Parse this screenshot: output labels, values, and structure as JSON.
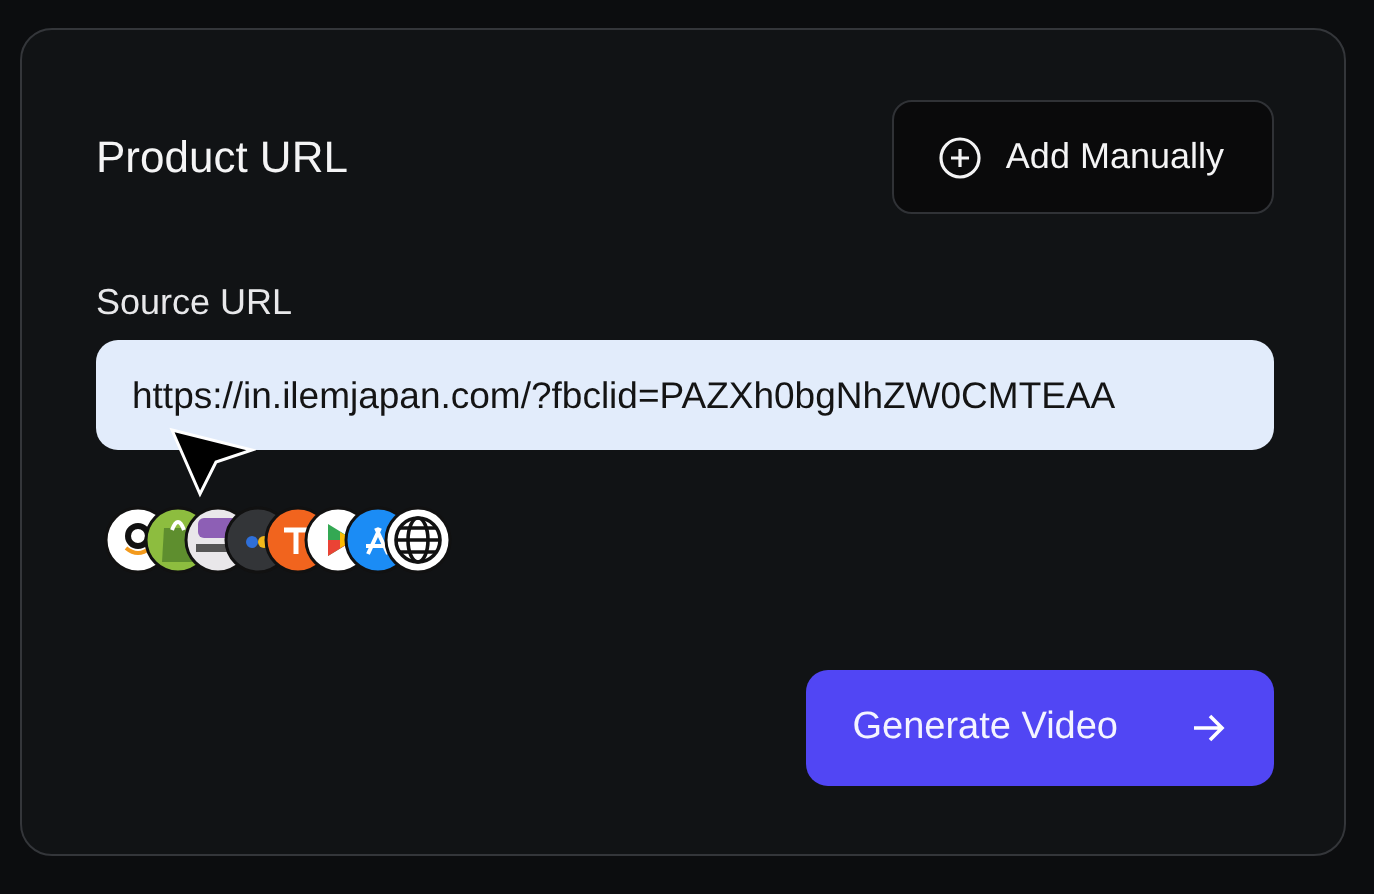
{
  "card": {
    "title": "Product URL",
    "add_button": {
      "label": "Add Manually"
    },
    "source": {
      "label": "Source URL",
      "value": "https://in.ilemjapan.com/?fbclid=PAZXh0bgNhZW0CMTEAA"
    },
    "platforms": [
      {
        "kind": "smile"
      },
      {
        "kind": "bag"
      },
      {
        "kind": "bubble"
      },
      {
        "kind": "dark"
      },
      {
        "kind": "orange"
      },
      {
        "kind": "play"
      },
      {
        "kind": "store"
      },
      {
        "kind": "globe"
      }
    ],
    "generate_button": {
      "label": "Generate Video"
    }
  }
}
